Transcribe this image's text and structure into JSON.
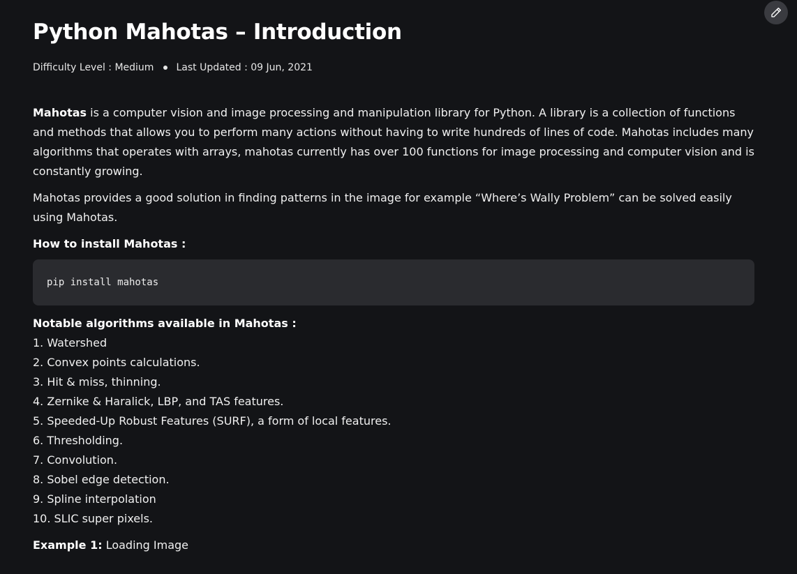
{
  "header": {
    "title": "Python Mahotas – Introduction",
    "difficulty": "Difficulty Level : Medium",
    "updated": "Last Updated : 09 Jun, 2021"
  },
  "intro": {
    "bold": "Mahotas",
    "rest": " is a computer vision and image processing and manipulation library for Python. A library is a collection of functions and methods that allows you to perform many actions without having to write hundreds of lines of code. Mahotas includes many algorithms that operates with arrays, mahotas currently has over 100 functions for image processing and computer vision and is constantly growing."
  },
  "para2": "Mahotas provides a good solution in finding patterns in the image for example “Where’s Wally Problem” can be solved easily using Mahotas.",
  "install": {
    "heading": "How to install Mahotas :",
    "code": "pip install mahotas"
  },
  "algorithms": {
    "heading": "Notable algorithms available in Mahotas :",
    "items": [
      "1. Watershed",
      "2. Convex points calculations.",
      "3. Hit & miss, thinning.",
      "4. Zernike & Haralick, LBP, and TAS features.",
      "5. Speeded-Up Robust Features (SURF), a form of local features.",
      "6. Thresholding.",
      "7. Convolution.",
      "8. Sobel edge detection.",
      "9. Spline interpolation",
      "10. SLIC super pixels."
    ]
  },
  "example": {
    "bold": "Example 1:",
    "rest": " Loading Image"
  },
  "icons": {
    "edit": "pencil-icon"
  },
  "colors": {
    "background": "#131417",
    "code_background": "#2a2b2f",
    "edit_button": "#3a3b40"
  }
}
